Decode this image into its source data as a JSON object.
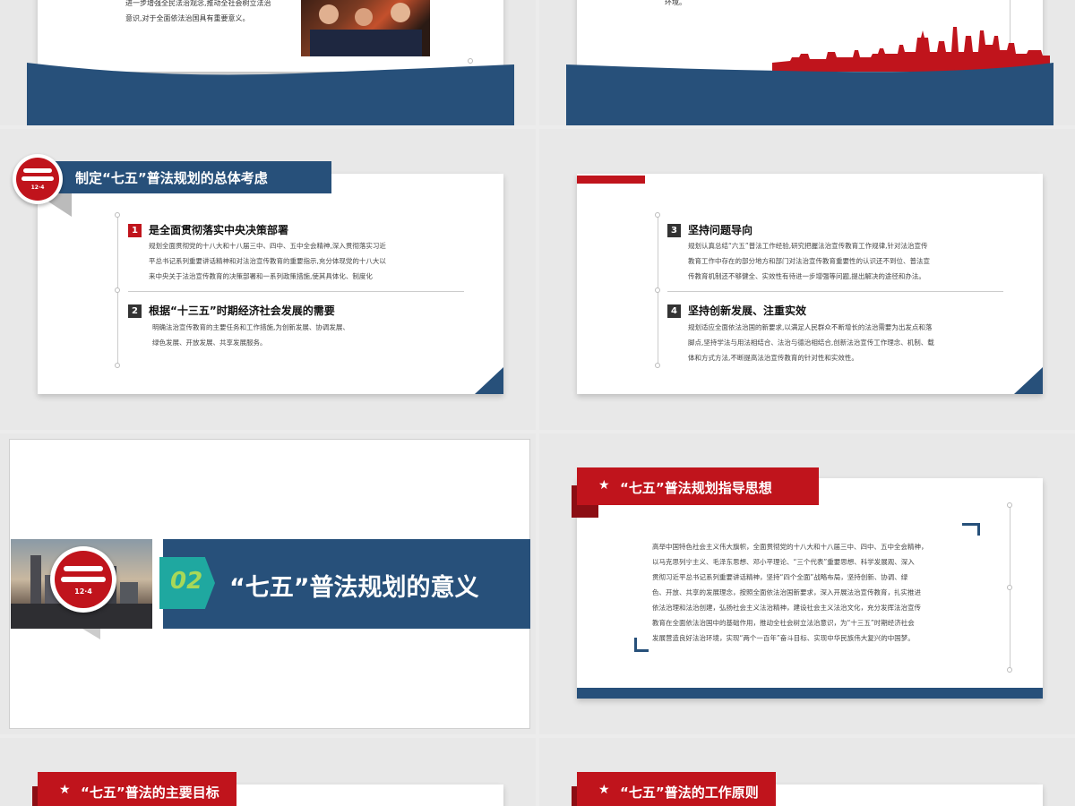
{
  "slide1": {
    "text_line1": "进一步增强全民法治观念,推动全社会树立法治",
    "text_line2": "意识,对于全面依法治国具有重要意义。"
  },
  "slide2": {
    "text_fragment": "环境。"
  },
  "slide3": {
    "logo_text": "12·4",
    "title": "制定“七五”普法规划的总体考虑",
    "item1": {
      "number": "1",
      "heading": "是全面贯彻落实中央决策部署",
      "lines": [
        "规划全面贯彻党的十八大和十八届三中、四中、五中全会精神,深入贯彻落实习近",
        "平总书记系列重要讲话精神和对法治宣传教育的重要指示,充分体现党的十八大以",
        "来中央关于法治宣传教育的决策部署和一系列政策措施,使其具体化、制度化"
      ]
    },
    "item2": {
      "number": "2",
      "heading": "根据“十三五”时期经济社会发展的需要",
      "lines": [
        "明确法治宣传教育的主要任务和工作措施,为创新发展、协调发展、",
        "绿色发展、开放发展、共享发展服务。"
      ]
    }
  },
  "slide4": {
    "item3": {
      "number": "3",
      "heading": "坚持问题导向",
      "lines": [
        "规划认真总结“六五”普法工作经验,研究把握法治宣传教育工作规律,针对法治宣传",
        "教育工作中存在的部分地方和部门对法治宣传教育重要性的认识还不到位、普法宣",
        "传教育机制还不够健全、实效性有待进一步增强等问题,提出解决的途径和办法。"
      ]
    },
    "item4": {
      "number": "4",
      "heading": "坚持创新发展、注重实效",
      "lines": [
        "规划适应全面依法治国的新要求,以满足人民群众不断增长的法治需要为出发点和落",
        "脚点,坚持学法与用法相结合、法治与德治相结合,创新法治宣传工作理念、机制、载",
        "体和方式方法,不断提高法治宣传教育的针对性和实效性。"
      ]
    }
  },
  "slide5": {
    "logo_text": "12·4",
    "section_number": "02",
    "title": "“七五”普法规划的意义"
  },
  "slide6": {
    "title": "“七五”普法规划指导思想",
    "lines": [
      "高举中国特色社会主义伟大旗帜，全面贯彻党的十八大和十八届三中、四中、五中全会精神，",
      "以马克思列宁主义、毛泽东思想、邓小平理论、“三个代表”重要思想、科学发展观、深入",
      "贯彻习近平总书记系列重要讲话精神，坚持“四个全面”战略布局，坚持创新、协调、绿",
      "色、开放、共享的发展理念，按照全面依法治国新要求，深入开展法治宣传教育，扎实推进",
      "依法治理和法治创建，弘扬社会主义法治精神，建设社会主义法治文化，充分发挥法治宣传",
      "教育在全面依法治国中的基础作用，推动全社会树立法治意识，为“十三五”时期经济社会",
      "发展营造良好法治环境，实现“两个一百年”奋斗目标、实现中华民族伟大复兴的中国梦。"
    ]
  },
  "slide7": {
    "title": "“七五”普法的主要目标"
  },
  "slide8": {
    "title": "“七五”普法的工作原则"
  },
  "colors": {
    "navy": "#27507a",
    "red": "#c0141c",
    "teal": "#1fa8a0"
  }
}
